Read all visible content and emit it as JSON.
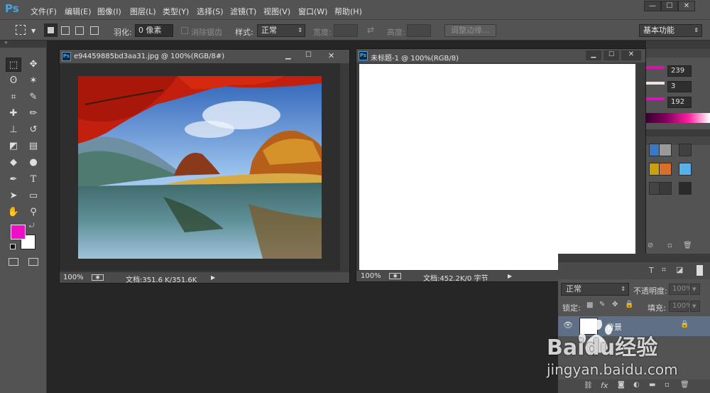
{
  "app": {
    "logo": "Ps",
    "menu": [
      "文件(F)",
      "编辑(E)",
      "图像(I)",
      "图层(L)",
      "类型(Y)",
      "选择(S)",
      "滤镜(T)",
      "视图(V)",
      "窗口(W)",
      "帮助(H)"
    ],
    "window_controls": [
      "—",
      "☐",
      "✕"
    ]
  },
  "options": {
    "feather_label": "羽化:",
    "feather_value": "0 像素",
    "antialias_label": "消除锯齿",
    "style_label": "样式:",
    "style_value": "正常",
    "width_label": "宽度:",
    "height_label": "高度:",
    "refine_edge_button": "调整边缘...",
    "workspace": "基本功能"
  },
  "toolbar": {
    "icons": [
      "rect-marquee-icon",
      "move-icon",
      "lasso-icon",
      "magic-wand-icon",
      "crop-icon",
      "eyedropper-icon",
      "healing-icon",
      "brush-icon",
      "stamp-icon",
      "history-brush-icon",
      "eraser-icon",
      "gradient-icon",
      "blur-icon",
      "dodge-icon",
      "pen-icon",
      "type-icon",
      "path-select-icon",
      "shape-icon",
      "hand-icon",
      "zoom-icon"
    ],
    "foreground_color": "#ee0ec7",
    "background_color": "#ffffff"
  },
  "doc1": {
    "title": "e94459885bd3aa31.jpg @ 100%(RGB/8#)",
    "zoom": "100%",
    "doc_size": "文档:351.6 K/351.6K"
  },
  "doc2": {
    "title": "未标题-1 @ 100%(RGB/8)",
    "zoom": "100%",
    "doc_size": "文档:452.2K/0 字节"
  },
  "color_panel": {
    "values": [
      "239",
      "3",
      "192"
    ]
  },
  "layers": {
    "blend_mode": "正常",
    "opacity_label": "不透明度:",
    "opacity_value": "100%",
    "lock_label": "锁定:",
    "fill_label": "填充:",
    "fill_value": "100%",
    "layer_name": "背景"
  },
  "watermark": {
    "brand": "Baidu经验",
    "url": "jingyan.baidu.com"
  }
}
